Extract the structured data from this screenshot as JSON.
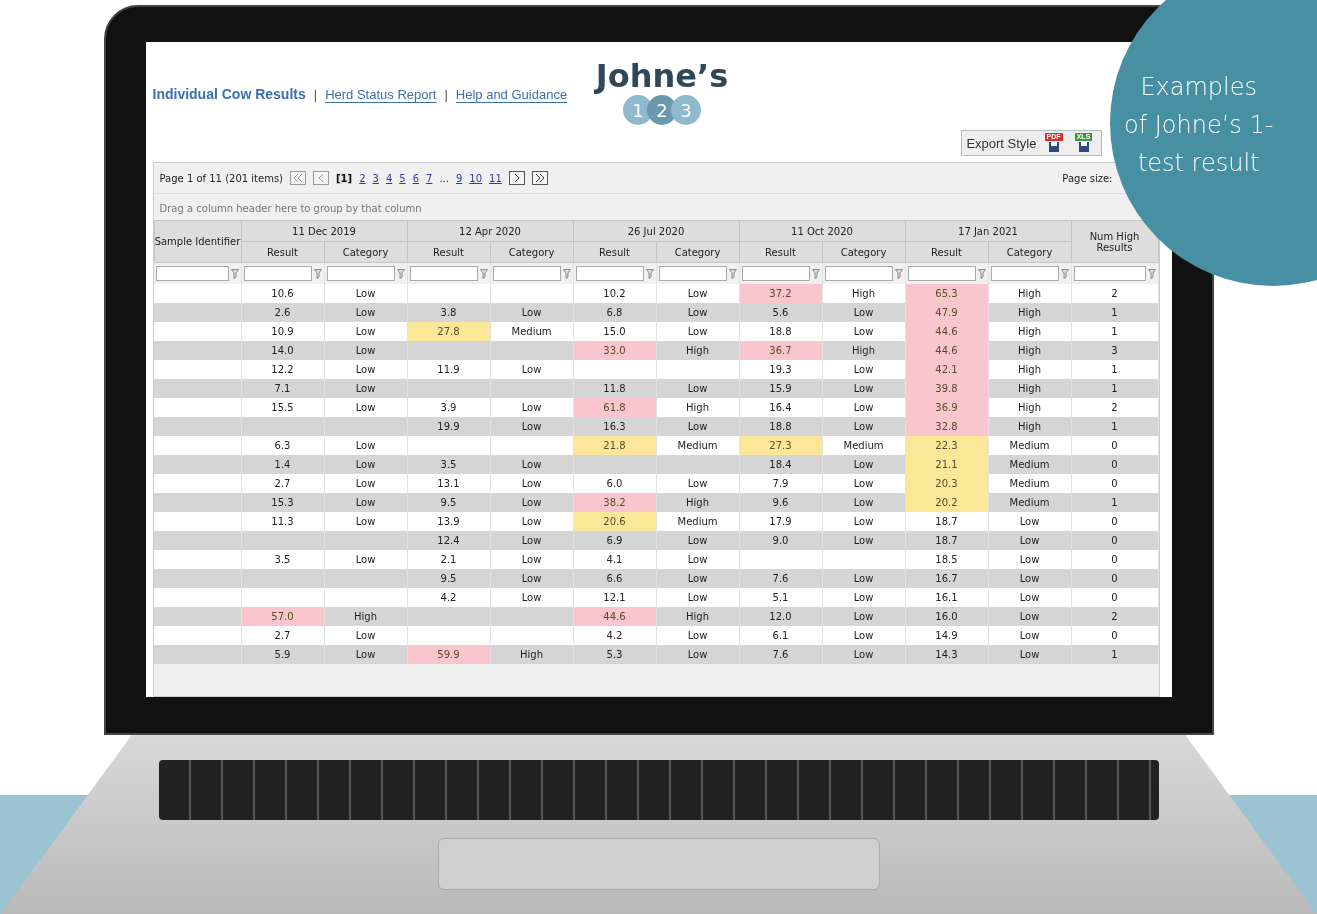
{
  "nav": {
    "links": [
      {
        "label": "Individual Cow Results",
        "selected": true
      },
      {
        "label": "Herd Status Report",
        "selected": false
      },
      {
        "label": "Help and Guidance",
        "selected": false
      }
    ],
    "separators": [
      "|",
      "|"
    ]
  },
  "logo": {
    "word": "Johne’s",
    "digits": [
      "1",
      "2",
      "3"
    ]
  },
  "export": {
    "label": "Export Style",
    "formats": [
      {
        "label": "PDF",
        "color": "#d9302c"
      },
      {
        "label": "XLS",
        "color": "#3c9a3c"
      }
    ]
  },
  "pager": {
    "summary": "Page 1 of 11 (201 items)",
    "pages": [
      {
        "label": "[1]",
        "selected": true
      },
      {
        "label": "2",
        "selected": false
      },
      {
        "label": "3",
        "selected": false
      },
      {
        "label": "4",
        "selected": false
      },
      {
        "label": "5",
        "selected": false
      },
      {
        "label": "6",
        "selected": false
      },
      {
        "label": "7",
        "selected": false
      },
      {
        "label": "...",
        "kind": "gap"
      },
      {
        "label": "9",
        "selected": false
      },
      {
        "label": "10",
        "selected": false
      },
      {
        "label": "11",
        "selected": false
      }
    ],
    "page_size_label": "Page size:"
  },
  "group_hint": "Drag a column header here to group by that column",
  "table": {
    "id_column": "Sample Identifier",
    "dates": [
      {
        "date": "11 Dec 2019",
        "columns": [
          "Result",
          "Category"
        ]
      },
      {
        "date": "12 Apr 2020",
        "columns": [
          "Result",
          "Category"
        ]
      },
      {
        "date": "26 Jul 2020",
        "columns": [
          "Result",
          "Category"
        ]
      },
      {
        "date": "11 Oct 2020",
        "columns": [
          "Result",
          "Category"
        ]
      },
      {
        "date": "17 Jan 2021",
        "columns": [
          "Result",
          "Category"
        ]
      }
    ],
    "total_column": "Num High Results",
    "rows": [
      {
        "test_1": {
          "result": "10.6",
          "category": "Low"
        },
        "test_3": {
          "result": "10.2",
          "category": "Low"
        },
        "test_4": {
          "result": "37.2",
          "category": "High",
          "color": "#f8c6cc"
        },
        "test_5": {
          "result": "65.3",
          "category": "High",
          "color": "#f8c6cc"
        },
        "num_high": "2"
      },
      {
        "test_1": {
          "result": "2.6",
          "category": "Low"
        },
        "test_2": {
          "result": "3.8",
          "category": "Low"
        },
        "test_3": {
          "result": "6.8",
          "category": "Low"
        },
        "test_4": {
          "result": "5.6",
          "category": "Low"
        },
        "test_5": {
          "result": "47.9",
          "category": "High",
          "color": "#f8c6cc"
        },
        "num_high": "1"
      },
      {
        "test_1": {
          "result": "10.9",
          "category": "Low"
        },
        "test_2": {
          "result": "27.8",
          "category": "Medium",
          "color": "#fbe798"
        },
        "test_3": {
          "result": "15.0",
          "category": "Low"
        },
        "test_4": {
          "result": "18.8",
          "category": "Low"
        },
        "test_5": {
          "result": "44.6",
          "category": "High",
          "color": "#f8c6cc"
        },
        "num_high": "1"
      },
      {
        "test_1": {
          "result": "14.0",
          "category": "Low"
        },
        "test_3": {
          "result": "33.0",
          "category": "High",
          "color": "#f8c6cc"
        },
        "test_4": {
          "result": "36.7",
          "category": "High",
          "color": "#f8c6cc"
        },
        "test_5": {
          "result": "44.6",
          "category": "High",
          "color": "#f8c6cc"
        },
        "num_high": "3"
      },
      {
        "test_1": {
          "result": "12.2",
          "category": "Low"
        },
        "test_2": {
          "result": "11.9",
          "category": "Low"
        },
        "test_4": {
          "result": "19.3",
          "category": "Low"
        },
        "test_5": {
          "result": "42.1",
          "category": "High",
          "color": "#f8c6cc"
        },
        "num_high": "1"
      },
      {
        "test_1": {
          "result": "7.1",
          "category": "Low"
        },
        "test_3": {
          "result": "11.8",
          "category": "Low"
        },
        "test_4": {
          "result": "15.9",
          "category": "Low"
        },
        "test_5": {
          "result": "39.8",
          "category": "High",
          "color": "#f8c6cc"
        },
        "num_high": "1"
      },
      {
        "test_1": {
          "result": "15.5",
          "category": "Low"
        },
        "test_2": {
          "result": "3.9",
          "category": "Low"
        },
        "test_3": {
          "result": "61.8",
          "category": "High",
          "color": "#f8c6cc"
        },
        "test_4": {
          "result": "16.4",
          "category": "Low"
        },
        "test_5": {
          "result": "36.9",
          "category": "High",
          "color": "#f8c6cc"
        },
        "num_high": "2"
      },
      {
        "test_2": {
          "result": "19.9",
          "category": "Low"
        },
        "test_3": {
          "result": "16.3",
          "category": "Low"
        },
        "test_4": {
          "result": "18.8",
          "category": "Low"
        },
        "test_5": {
          "result": "32.8",
          "category": "High",
          "color": "#f8c6cc"
        },
        "num_high": "1"
      },
      {
        "test_1": {
          "result": "6.3",
          "category": "Low"
        },
        "test_3": {
          "result": "21.8",
          "category": "Medium",
          "color": "#fbe798"
        },
        "test_4": {
          "result": "27.3",
          "category": "Medium",
          "color": "#fbe798"
        },
        "test_5": {
          "result": "22.3",
          "category": "Medium",
          "color": "#fbe798"
        },
        "num_high": "0"
      },
      {
        "test_1": {
          "result": "1.4",
          "category": "Low"
        },
        "test_2": {
          "result": "3.5",
          "category": "Low"
        },
        "test_4": {
          "result": "18.4",
          "category": "Low"
        },
        "test_5": {
          "result": "21.1",
          "category": "Medium",
          "color": "#fbe798"
        },
        "num_high": "0"
      },
      {
        "test_1": {
          "result": "2.7",
          "category": "Low"
        },
        "test_2": {
          "result": "13.1",
          "category": "Low"
        },
        "test_3": {
          "result": "6.0",
          "category": "Low"
        },
        "test_4": {
          "result": "7.9",
          "category": "Low"
        },
        "test_5": {
          "result": "20.3",
          "category": "Medium",
          "color": "#fbe798"
        },
        "num_high": "0"
      },
      {
        "test_1": {
          "result": "15.3",
          "category": "Low"
        },
        "test_2": {
          "result": "9.5",
          "category": "Low"
        },
        "test_3": {
          "result": "38.2",
          "category": "High",
          "color": "#f8c6cc"
        },
        "test_4": {
          "result": "9.6",
          "category": "Low"
        },
        "test_5": {
          "result": "20.2",
          "category": "Medium",
          "color": "#fbe798"
        },
        "num_high": "1"
      },
      {
        "test_1": {
          "result": "11.3",
          "category": "Low"
        },
        "test_2": {
          "result": "13.9",
          "category": "Low"
        },
        "test_3": {
          "result": "20.6",
          "category": "Medium",
          "color": "#fbe798"
        },
        "test_4": {
          "result": "17.9",
          "category": "Low"
        },
        "test_5": {
          "result": "18.7",
          "category": "Low"
        },
        "num_high": "0"
      },
      {
        "test_2": {
          "result": "12.4",
          "category": "Low"
        },
        "test_3": {
          "result": "6.9",
          "category": "Low"
        },
        "test_4": {
          "result": "9.0",
          "category": "Low"
        },
        "test_5": {
          "result": "18.7",
          "category": "Low"
        },
        "num_high": "0"
      },
      {
        "test_1": {
          "result": "3.5",
          "category": "Low"
        },
        "test_2": {
          "result": "2.1",
          "category": "Low"
        },
        "test_3": {
          "result": "4.1",
          "category": "Low"
        },
        "test_5": {
          "result": "18.5",
          "category": "Low"
        },
        "num_high": "0"
      },
      {
        "test_2": {
          "result": "9.5",
          "category": "Low"
        },
        "test_3": {
          "result": "6.6",
          "category": "Low"
        },
        "test_4": {
          "result": "7.6",
          "category": "Low"
        },
        "test_5": {
          "result": "16.7",
          "category": "Low"
        },
        "num_high": "0"
      },
      {
        "test_2": {
          "result": "4.2",
          "category": "Low"
        },
        "test_3": {
          "result": "12.1",
          "category": "Low"
        },
        "test_4": {
          "result": "5.1",
          "category": "Low"
        },
        "test_5": {
          "result": "16.1",
          "category": "Low"
        },
        "num_high": "0"
      },
      {
        "test_1": {
          "result": "57.0",
          "category": "High",
          "color": "#f8c6cc"
        },
        "test_3": {
          "result": "44.6",
          "category": "High",
          "color": "#f8c6cc"
        },
        "test_4": {
          "result": "12.0",
          "category": "Low"
        },
        "test_5": {
          "result": "16.0",
          "category": "Low"
        },
        "num_high": "2"
      },
      {
        "test_1": {
          "result": "2.7",
          "category": "Low"
        },
        "test_3": {
          "result": "4.2",
          "category": "Low"
        },
        "test_4": {
          "result": "6.1",
          "category": "Low"
        },
        "test_5": {
          "result": "14.9",
          "category": "Low"
        },
        "num_high": "0"
      },
      {
        "test_1": {
          "result": "5.9",
          "category": "Low"
        },
        "test_2": {
          "result": "59.9",
          "category": "High",
          "color": "#f8c6cc"
        },
        "test_3": {
          "result": "5.3",
          "category": "Low"
        },
        "test_4": {
          "result": "7.6",
          "category": "Low"
        },
        "test_5": {
          "result": "14.3",
          "category": "Low"
        },
        "num_high": "1"
      }
    ]
  },
  "overlay": {
    "lines": [
      "Examples",
      "of Johne’s 1-",
      "test result"
    ]
  }
}
